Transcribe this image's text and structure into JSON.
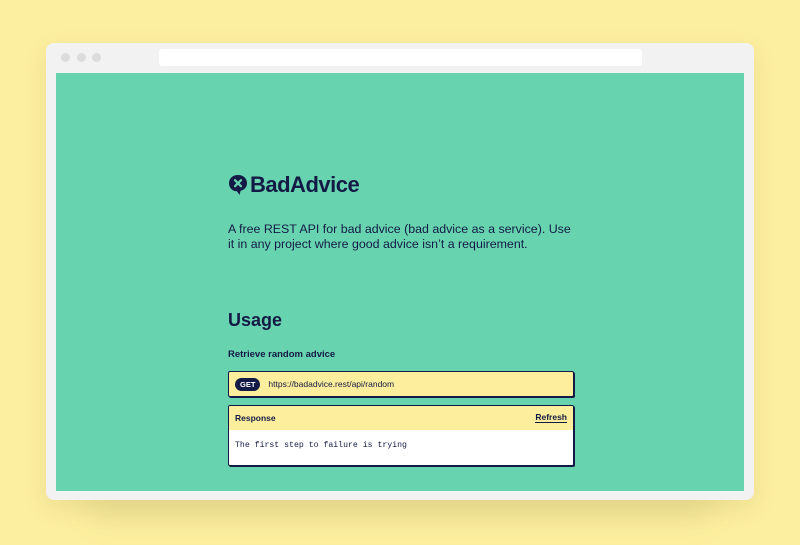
{
  "colors": {
    "page_background": "#fcef9f",
    "site_background": "#68d4af",
    "navy": "#131a45",
    "highlight_yellow": "#fcee9c"
  },
  "browser": {
    "window_dots": [
      "close-dot",
      "minimize-dot",
      "maximize-dot"
    ],
    "address_value": ""
  },
  "brand": {
    "logo_icon": "speech-bubble-x-icon",
    "name": "BadAdvice"
  },
  "intro": "A free REST API for bad advice (bad advice as a service). Use it in any project where good advice isn’t a requirement.",
  "usage": {
    "heading": "Usage",
    "subheading": "Retrieve random advice",
    "endpoint": {
      "method": "GET",
      "url": "https://badadvice.rest/api/random"
    },
    "response": {
      "label": "Response",
      "refresh_label": "Refresh",
      "body": "The first step to failure is trying"
    }
  }
}
